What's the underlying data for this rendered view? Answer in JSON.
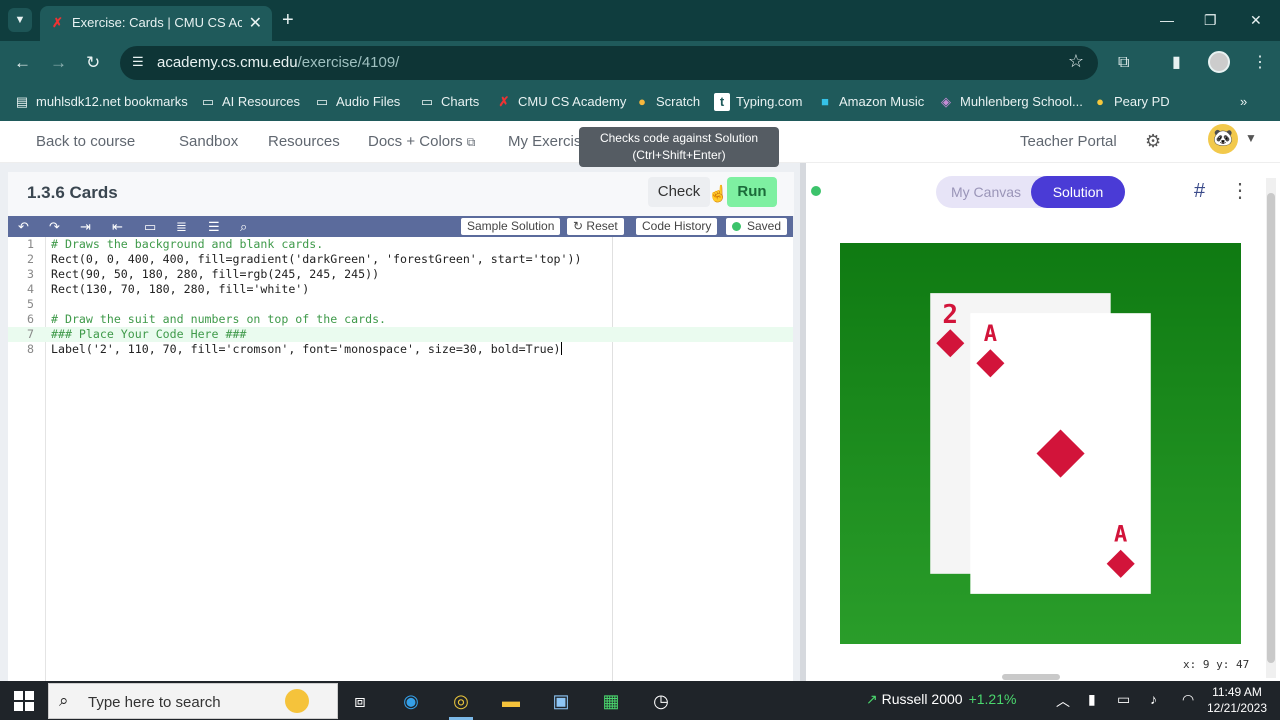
{
  "browser": {
    "tab_title": "Exercise: Cards | CMU CS Academy",
    "url_host": "academy.cs.cmu.edu",
    "url_path": "/exercise/4109/",
    "bookmarks": [
      {
        "label": "muhlsdk12.net bookmarks",
        "icon": "bookmarks-icon"
      },
      {
        "label": "AI Resources",
        "icon": "folder-icon"
      },
      {
        "label": "Audio Files",
        "icon": "folder-icon"
      },
      {
        "label": "Charts",
        "icon": "folder-icon"
      },
      {
        "label": "CMU CS Academy",
        "icon": "cmu-icon"
      },
      {
        "label": "Scratch",
        "icon": "scratch-icon"
      },
      {
        "label": "Typing.com",
        "icon": "typing-icon"
      },
      {
        "label": "Amazon Music",
        "icon": "amazon-music-icon"
      },
      {
        "label": "Muhlenberg School...",
        "icon": "muhlenberg-icon"
      },
      {
        "label": "Peary PD",
        "icon": "peary-icon"
      }
    ]
  },
  "nav": {
    "back": "Back to course",
    "sandbox": "Sandbox",
    "resources": "Resources",
    "docs": "Docs + Colors",
    "my_exercises": "My Exercises",
    "teacher_portal": "Teacher Portal"
  },
  "exercise": {
    "title": "1.3.6 Cards",
    "check": "Check",
    "run": "Run",
    "tooltip_line1": "Checks code against Solution",
    "tooltip_line2": "(Ctrl+Shift+Enter)"
  },
  "toolbar": {
    "sample_solution": "Sample Solution",
    "reset": "Reset",
    "code_history": "Code History",
    "saved": "Saved"
  },
  "code": {
    "lines": [
      "# Draws the background and blank cards.",
      "Rect(0, 0, 400, 400, fill=gradient('darkGreen', 'forestGreen', start='top'))",
      "Rect(90, 50, 180, 280, fill=rgb(245, 245, 245))",
      "Rect(130, 70, 180, 280, fill='white')",
      "",
      "# Draw the suit and numbers on top of the cards.",
      "### Place Your Code Here ###",
      "Label('2', 110, 70, fill='cromson', font='monospace', size=30, bold=True)"
    ],
    "line_numbers": [
      "1",
      "2",
      "3",
      "4",
      "5",
      "6",
      "7",
      "8"
    ]
  },
  "canvas_panel": {
    "my_canvas": "My Canvas",
    "solution": "Solution",
    "coords": "x: 9  y: 47",
    "card_back_label": "2",
    "card_front_top_label": "A",
    "card_front_bottom_label": "A",
    "colors": {
      "bg_top": "#0f7a12",
      "bg_bottom": "#2a9d2a",
      "card_back": "#f5f5f5",
      "card_front": "#ffffff",
      "suit": "#d2143a"
    }
  },
  "taskbar": {
    "search_placeholder": "Type here to search",
    "stock_name": "Russell 2000",
    "stock_change": "+1.21%",
    "time": "11:49 AM",
    "date": "12/21/2023"
  }
}
